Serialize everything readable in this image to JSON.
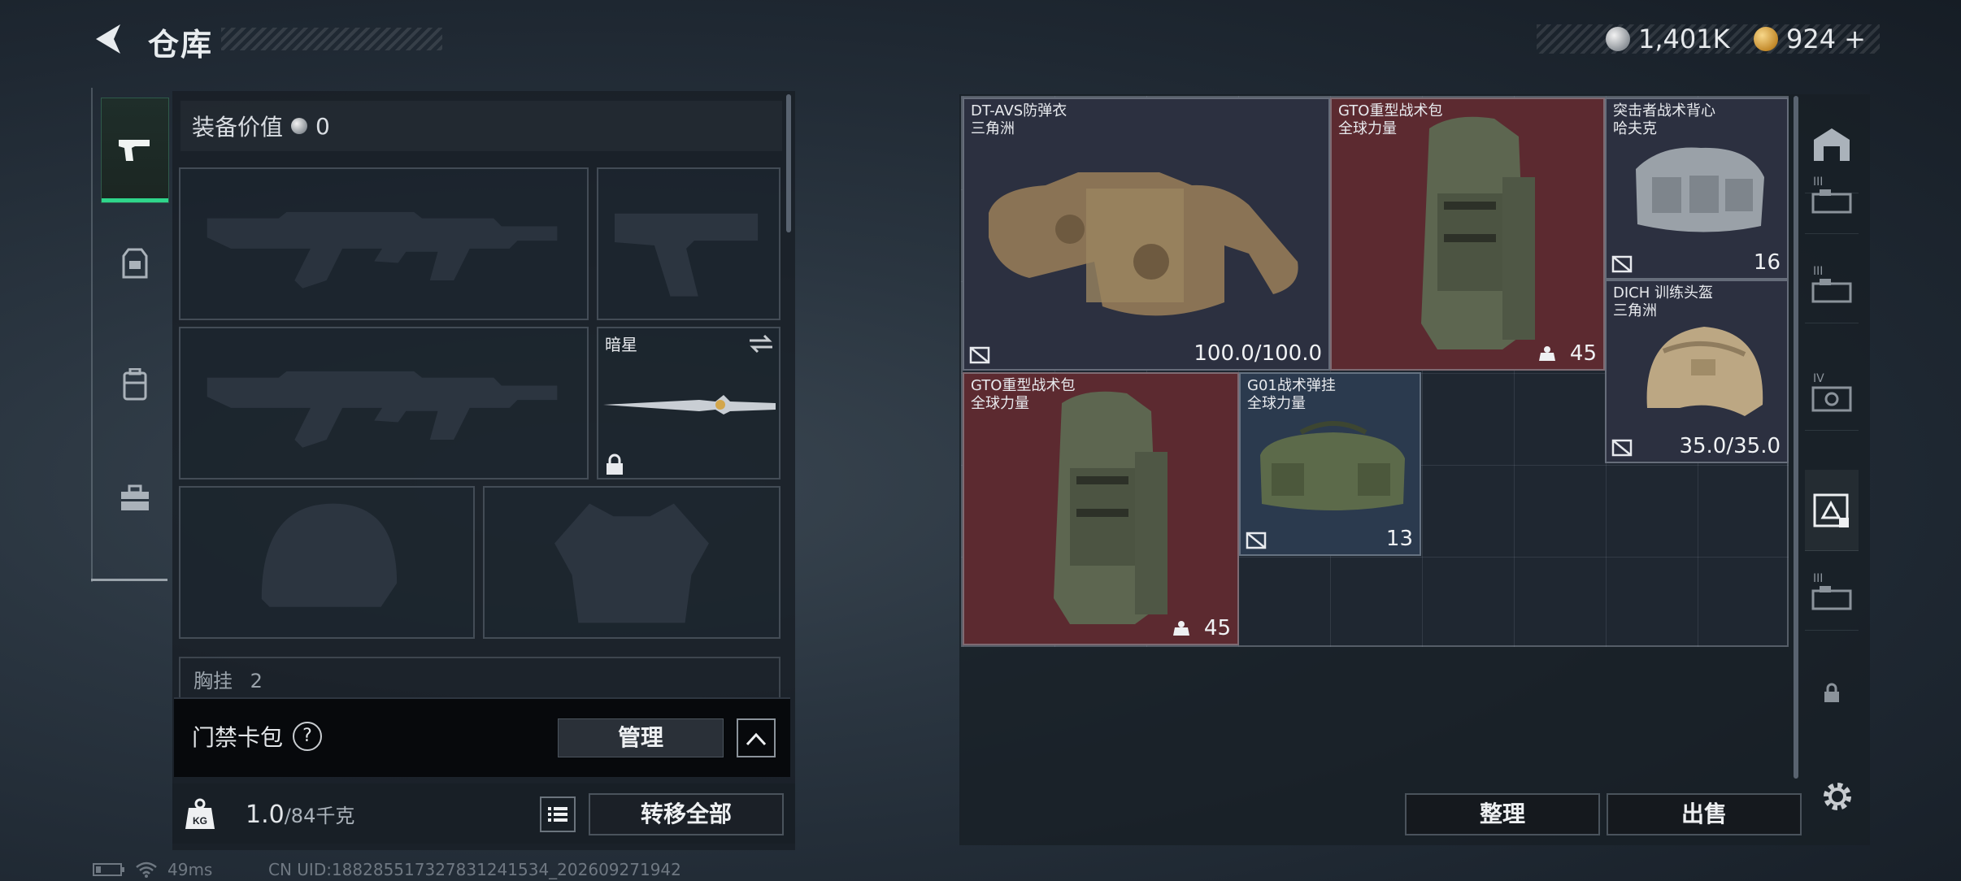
{
  "header": {
    "title": "仓库"
  },
  "currency": [
    {
      "icon": "silver-coin-icon",
      "value": "1,401K"
    },
    {
      "icon": "gold-coin-icon",
      "value": "924",
      "plus": "+"
    }
  ],
  "loadout": {
    "equip_value_label": "装备价值",
    "equip_value": "0",
    "melee_name": "暗星",
    "chest_label": "胸挂",
    "chest_count": "2"
  },
  "card_pack": {
    "label": "门禁卡包",
    "help": "?",
    "manage": "管理"
  },
  "weight": {
    "current": "1.0",
    "max": "/84",
    "unit": "千克"
  },
  "transfer_all": "转移全部",
  "status": {
    "ping": "49ms",
    "uid": "CN UID:18828551732783124153​4_202609271942"
  },
  "items": [
    {
      "name": "DT-AVS防弹衣",
      "sub": "三角洲",
      "value": "100.0/100.0"
    },
    {
      "name": "GTO重型战术包",
      "sub": "全球力量",
      "value": "45"
    },
    {
      "name": "突击者战术背心",
      "sub": "哈夫克",
      "value": "16"
    },
    {
      "name": "DICH 训练头盔",
      "sub": "三角洲",
      "value": "35.0/35.0"
    },
    {
      "name": "GTO重型战术包",
      "sub": "全球力量",
      "value": "45"
    },
    {
      "name": "G01战术弹挂",
      "sub": "全球力量",
      "value": "13"
    }
  ],
  "right_rail": [
    "III",
    "III",
    "IV",
    "III",
    "III"
  ],
  "buttons": {
    "sort": "整理",
    "sell": "出售"
  },
  "colors": {
    "accent_green": "#2fd58b",
    "item_red": "#5c2a30",
    "item_navy": "#2c3040",
    "item_blue": "#2b3a4e"
  }
}
